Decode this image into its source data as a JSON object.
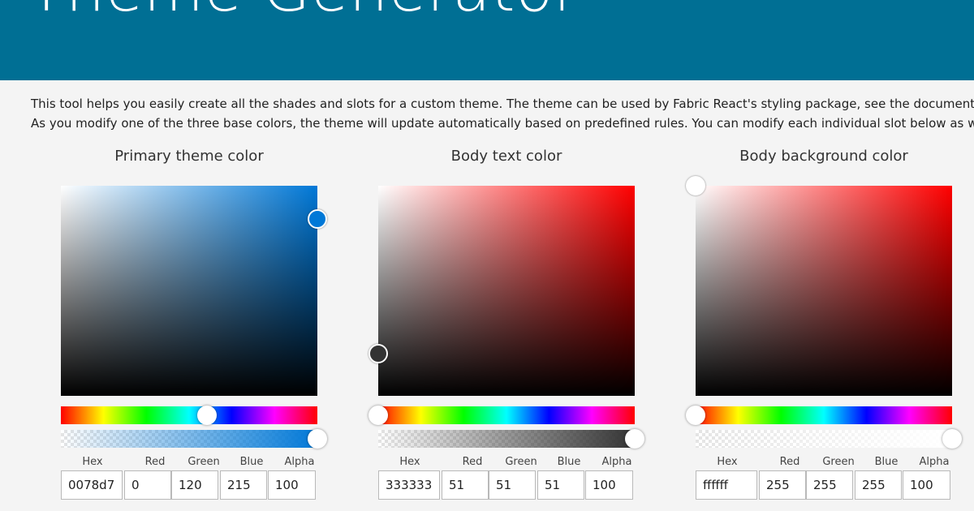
{
  "banner": {
    "title": "Theme Generator",
    "color": "#006f94"
  },
  "intro": {
    "line1": "This tool helps you easily create all the shades and slots for a custom theme. The theme can be used by Fabric React's styling package, see the documentation.",
    "line2": "As you modify one of the three base colors, the theme will update automatically based on predefined rules. You can modify each individual slot below as well."
  },
  "field_labels": {
    "hex": "Hex",
    "red": "Red",
    "green": "Green",
    "blue": "Blue",
    "alpha": "Alpha"
  },
  "pickers": [
    {
      "title": "Primary theme color",
      "hue_color": "#0078d7",
      "color": "#0078d7",
      "saturation": 1.0,
      "brightness": 0.84,
      "hue_position": 0.57,
      "alpha_position": 1.0,
      "hex": "0078d7",
      "red": "0",
      "green": "120",
      "blue": "215",
      "alpha": "100"
    },
    {
      "title": "Body text color",
      "hue_color": "#ff0000",
      "color": "#333333",
      "saturation": 0.0,
      "brightness": 0.2,
      "hue_position": 0.0,
      "alpha_position": 1.0,
      "hex": "333333",
      "red": "51",
      "green": "51",
      "blue": "51",
      "alpha": "100"
    },
    {
      "title": "Body background color",
      "hue_color": "#ff0000",
      "color": "#ffffff",
      "saturation": 0.0,
      "brightness": 1.0,
      "hue_position": 0.0,
      "alpha_position": 1.0,
      "hex": "ffffff",
      "red": "255",
      "green": "255",
      "blue": "255",
      "alpha": "100"
    }
  ]
}
